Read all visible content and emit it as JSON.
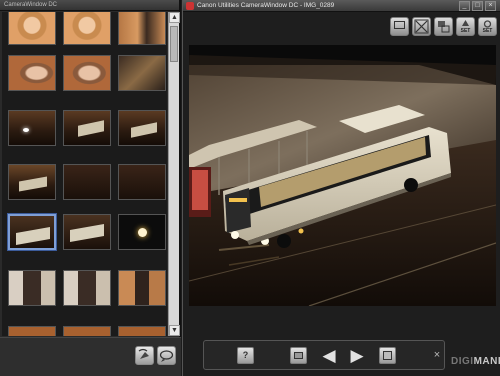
{
  "left_window": {
    "title": "CameraWindow DC",
    "thumbnail_rows": [
      {
        "thumbs": [
          "indoor-orange",
          "indoor-orange",
          "indoor-dark-figure"
        ]
      },
      {
        "thumbs": [
          "portrait-man",
          "portrait-man",
          "room-dim"
        ]
      },
      {
        "thumbs": [
          "bus-night",
          "bus-night",
          "bus-night"
        ]
      },
      {
        "thumbs": [
          "bus-night",
          "street-dark",
          "street-dark"
        ]
      },
      {
        "thumbs": [
          "bus-night",
          "bus-night",
          "light-dark"
        ]
      },
      {
        "thumbs": [
          "doorway-figure",
          "doorway-figure",
          "doorway-figure"
        ]
      }
    ],
    "selected_thumb": "row5-col1",
    "bottom_buttons": [
      "rotate-icon",
      "share-icon"
    ]
  },
  "right_window": {
    "title": "Canon Utilities CameraWindow DC - IMG_0289",
    "window_controls": {
      "minimize": "_",
      "maximize": "□",
      "close": "×"
    },
    "toolbar": {
      "buttons": [
        "layout-icon",
        "fit-screen-icon",
        "import-icon",
        "set-icon",
        "set-icon"
      ],
      "set_label_1": "SET",
      "set_label_2": "SET"
    },
    "photo": {
      "subject": "night-bus-at-stop",
      "accent": "#f2d06b"
    },
    "nav": {
      "help_label": "?",
      "prev_glyph": "◀",
      "next_glyph": "▶",
      "close_glyph": "×"
    },
    "watermark": {
      "part1": "DIGI",
      "part2": "MANIE"
    }
  },
  "colors": {
    "selection": "#7f9fd6",
    "bg": "#1c1c1c",
    "bus_body": "#d9d2c0",
    "warm_light": "#f2c14e"
  }
}
